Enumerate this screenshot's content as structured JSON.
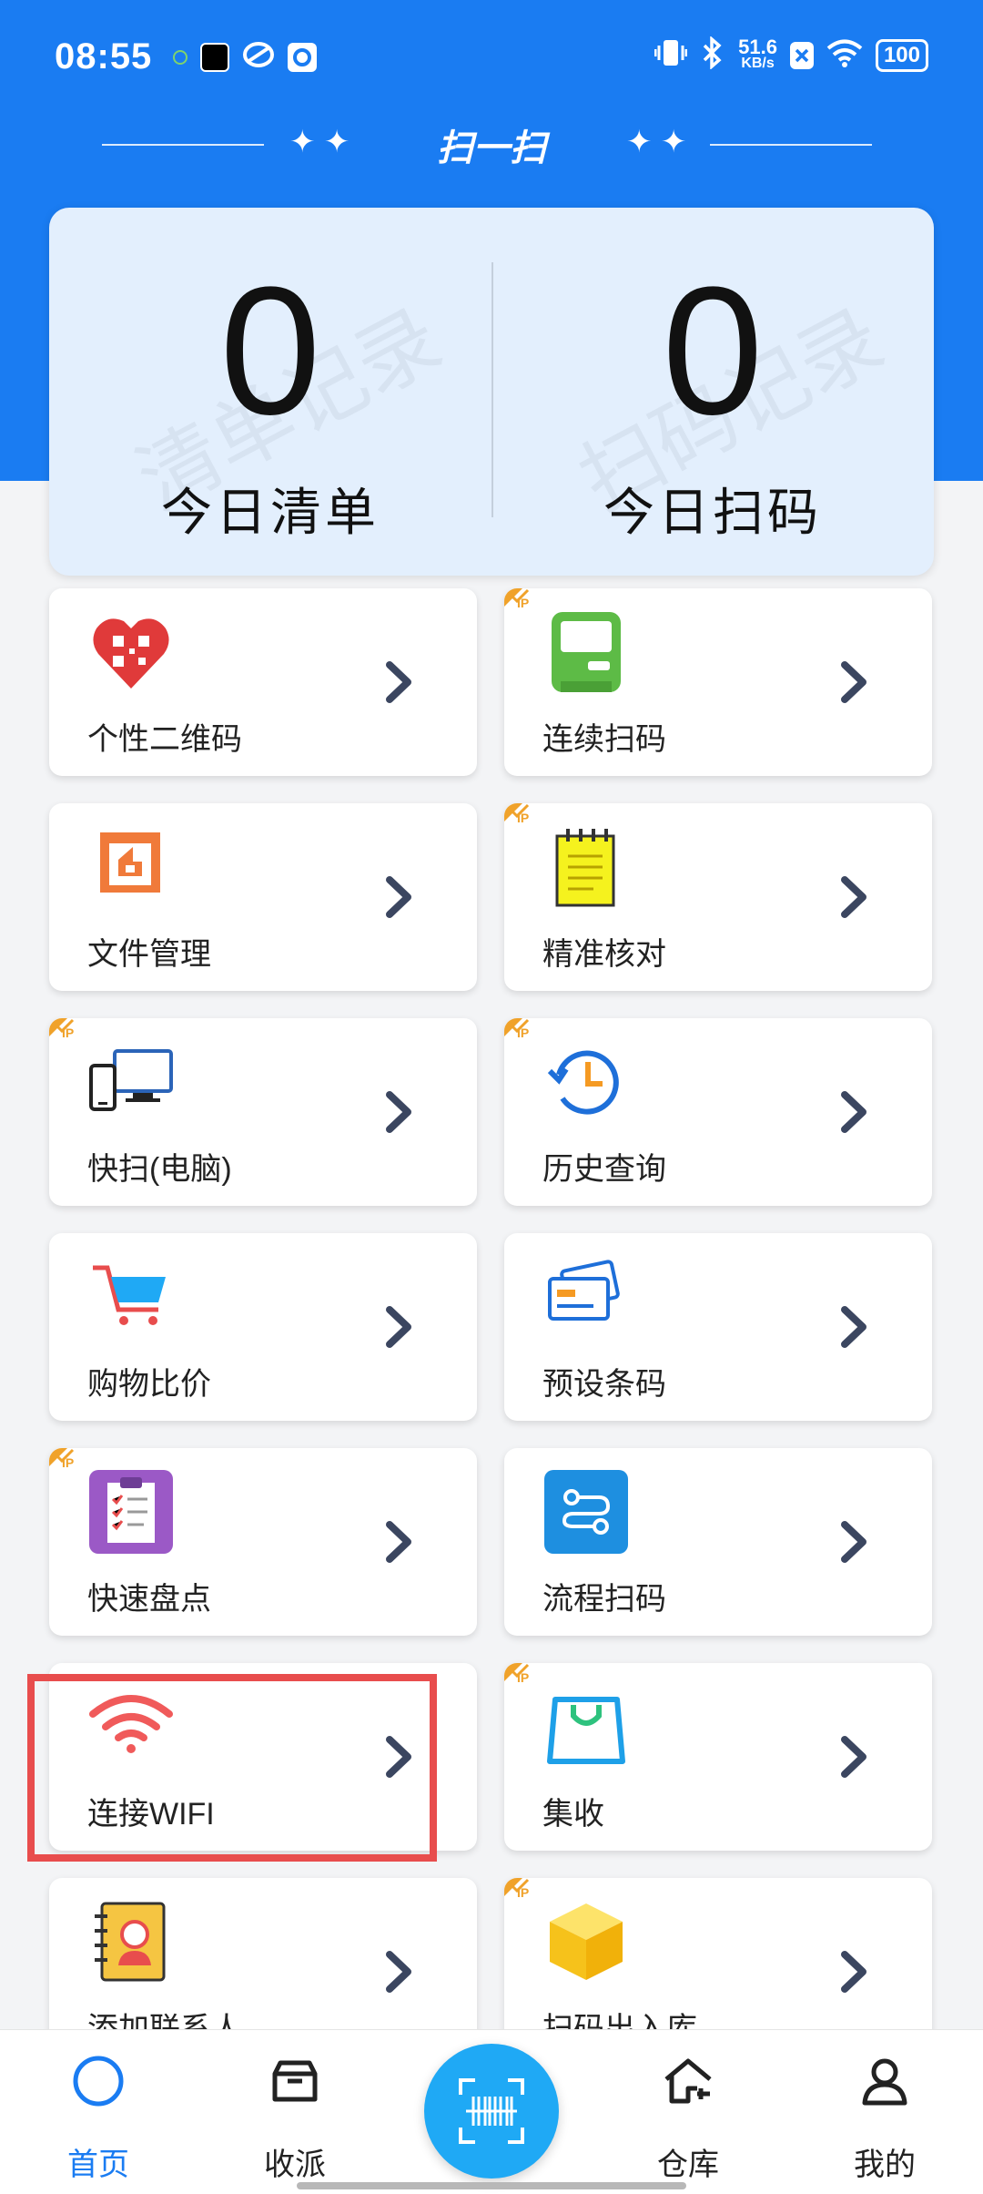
{
  "status_bar": {
    "time": "08:55",
    "net_speed_value": "51.6",
    "net_speed_unit": "KB/s",
    "battery": "100",
    "icons": [
      "notification-dot-icon",
      "tiktok-icon",
      "browser-icon",
      "app-icon",
      "vibrate-icon",
      "bluetooth-icon",
      "net-speed",
      "x-icon",
      "wifi-icon",
      "battery-icon"
    ]
  },
  "header": {
    "title": "扫一扫",
    "color": "#1a7cf2"
  },
  "stats": {
    "left": {
      "value": "0",
      "label": "今日清单",
      "watermark": "清单记录"
    },
    "right": {
      "value": "0",
      "label": "今日扫码",
      "watermark": "扫码记录"
    }
  },
  "tiles": [
    {
      "label": "个性二维码",
      "icon": "fingerprint-qr-heart-icon",
      "vip": false
    },
    {
      "label": "连续扫码",
      "icon": "green-terminal-icon",
      "vip": true
    },
    {
      "label": "文件管理",
      "icon": "folder-frame-icon",
      "vip": false
    },
    {
      "label": "精准核对",
      "icon": "yellow-notepad-icon",
      "vip": true
    },
    {
      "label": "快扫(电脑)",
      "icon": "phone-computer-icon",
      "vip": true
    },
    {
      "label": "历史查询",
      "icon": "history-clock-icon",
      "vip": true
    },
    {
      "label": "购物比价",
      "icon": "shopping-cart-icon",
      "vip": false
    },
    {
      "label": "预设条码",
      "icon": "preset-card-icon",
      "vip": false
    },
    {
      "label": "快速盘点",
      "icon": "clipboard-checklist-icon",
      "vip": true
    },
    {
      "label": "流程扫码",
      "icon": "workflow-icon",
      "vip": false
    },
    {
      "label": "连接WIFI",
      "icon": "wifi-icon",
      "vip": false
    },
    {
      "label": "集收",
      "icon": "shopping-bag-icon",
      "vip": true
    },
    {
      "label": "添加联系人",
      "icon": "contact-book-icon",
      "vip": false
    },
    {
      "label": "扫码出入库",
      "icon": "yellow-box-icon",
      "vip": true
    }
  ],
  "vip_badge": "IP",
  "bottom_nav": [
    {
      "label": "首页",
      "icon": "home-circle-icon",
      "active": true
    },
    {
      "label": "收派",
      "icon": "box-icon",
      "active": false
    },
    {
      "label": "",
      "icon": "scan-barcode-icon",
      "active": false
    },
    {
      "label": "仓库",
      "icon": "warehouse-icon",
      "active": false
    },
    {
      "label": "我的",
      "icon": "profile-icon",
      "active": false
    }
  ],
  "colors": {
    "accent": "#1a7cf2",
    "fab": "#1fa9f5",
    "highlight_border": "#e84d4d",
    "vip_orange": "#f0a22a",
    "chevron": "#3b4660"
  }
}
